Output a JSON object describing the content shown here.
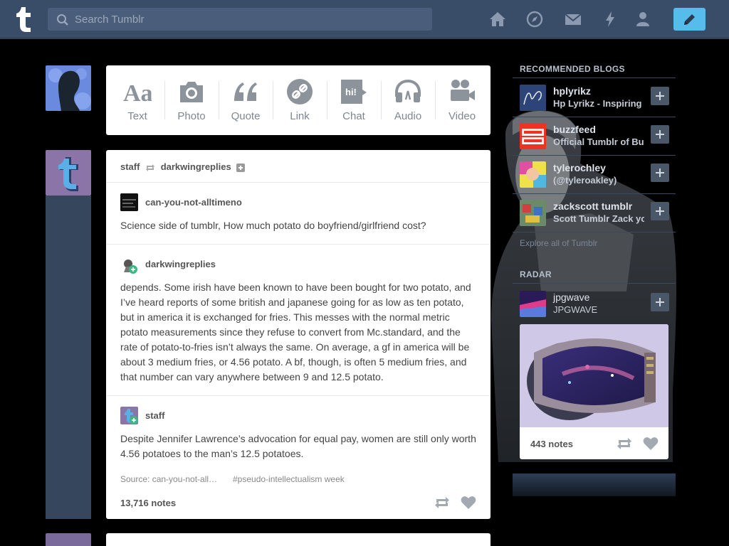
{
  "header": {
    "search_placeholder": "Search Tumblr",
    "nav_icons": [
      "home-icon",
      "explore-icon",
      "inbox-icon",
      "activity-icon",
      "account-icon"
    ],
    "compose_icon": "pencil-icon"
  },
  "colors": {
    "header": "#3a4d68",
    "dashboard": "#000000",
    "compose": "#56bcec",
    "card": "#ffffff"
  },
  "post_types": [
    {
      "label": "Text",
      "icon": "text-icon"
    },
    {
      "label": "Photo",
      "icon": "camera-icon"
    },
    {
      "label": "Quote",
      "icon": "quote-icon"
    },
    {
      "label": "Link",
      "icon": "link-icon"
    },
    {
      "label": "Chat",
      "icon": "chat-icon",
      "badge": "hi!"
    },
    {
      "label": "Audio",
      "icon": "headphones-icon"
    },
    {
      "label": "Video",
      "icon": "video-camera-icon"
    }
  ],
  "post": {
    "rebloggers": {
      "from": "staff",
      "to": "darkwingreplies"
    },
    "entries": [
      {
        "user": "can-you-not-alltimeno",
        "text": "Science side of tumblr, How much potato do boyfriend/girlfriend cost?"
      },
      {
        "user": "darkwingreplies",
        "text": "depends. Some irish have been known to have been bought for two potato, and I’ve heard reports of some british and japanese going for as low as ten potato, but in america it is exchanged for fries. This messes with the normal metric potato measurements since they refuse to convert from Mc.standard, and the rate of potato-to-fries isn’t always the same. On average, a gf in america will be about 3 medium fries, or 4.56 potato. A bf, though, is often 5 medium fries, and that number can vary anywhere between 9 and 12.5 potato."
      },
      {
        "user": "staff",
        "text": "Despite Jennifer Lawrence’s advocation for equal pay, women are still only worth 4.56 potatoes to the man’s 12.5 potatoes."
      }
    ],
    "source": "Source: can-you-not-all…",
    "tag": "#pseudo-intellectualism week",
    "notes": "13,716 notes"
  },
  "sidebar": {
    "recommended_title": "RECOMMENDED BLOGS",
    "blogs": [
      {
        "name": "hplyrikz",
        "desc": "Hp Lyrikz - Inspiring"
      },
      {
        "name": "buzzfeed",
        "desc": "Official Tumblr of Bu"
      },
      {
        "name": "tylerochley",
        "desc": "(@tyleroakley)"
      },
      {
        "name": "zackscott tumblr",
        "desc": "Scott Tumblr Zack yo"
      }
    ],
    "explore": "Explore all of Tumblr",
    "radar_title": "RADAR",
    "radar": {
      "name": "jpgwave",
      "desc": "JPGWAVE",
      "notes": "443 notes"
    }
  }
}
